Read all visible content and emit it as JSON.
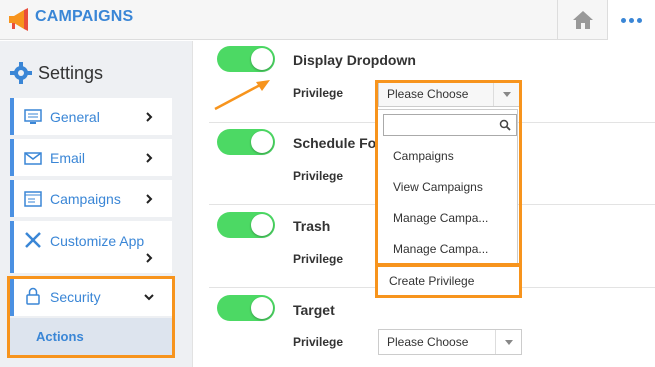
{
  "header": {
    "app_title": "CAMPAIGNS",
    "home_icon": "home-icon",
    "more_icon": "more-dots-icon",
    "accent": "#3a86d6"
  },
  "sidebar": {
    "heading": "Settings",
    "items": [
      {
        "label": "General",
        "icon": "monitor-icon"
      },
      {
        "label": "Email",
        "icon": "envelope-icon"
      },
      {
        "label": "Campaigns",
        "icon": "campaign-list-icon"
      },
      {
        "label": "Customize App",
        "icon": "tools-icon"
      },
      {
        "label": "Security",
        "icon": "lock-icon"
      }
    ],
    "sub_items": [
      {
        "label": "Actions"
      }
    ]
  },
  "rows": [
    {
      "title": "Display Dropdown",
      "privilege_label": "Privilege",
      "enabled": true,
      "select_value": "Please Choose"
    },
    {
      "title": "Schedule Fo",
      "privilege_label": "Privilege",
      "enabled": true
    },
    {
      "title": "Trash",
      "privilege_label": "Privilege",
      "enabled": true
    },
    {
      "title": "Target",
      "privilege_label": "Privilege",
      "enabled": true,
      "select_value": "Please Choose"
    }
  ],
  "dropdown": {
    "search_placeholder": "",
    "options": [
      "Campaigns",
      "View Campaigns",
      "Manage Campa...",
      "Manage Campa..."
    ],
    "create_label": "Create Privilege"
  },
  "colors": {
    "toggle_on": "#4cd964",
    "highlight": "#f7941d"
  }
}
